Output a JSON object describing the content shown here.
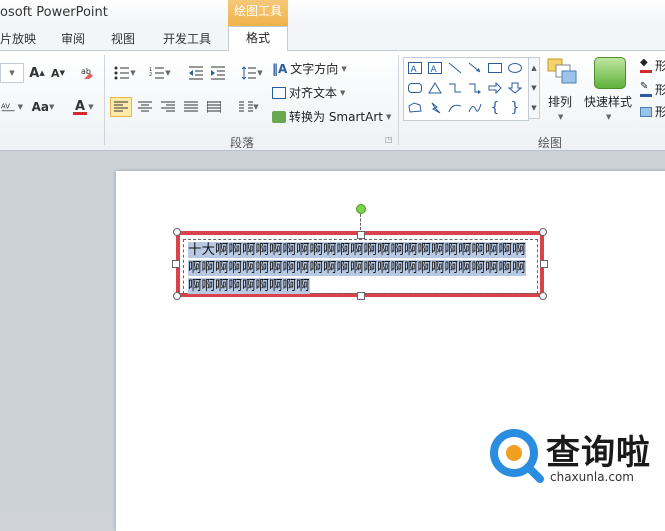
{
  "titlebar": {
    "app_title": "osoft PowerPoint",
    "context_group": "绘图工具"
  },
  "tabs": [
    {
      "label": "片放映"
    },
    {
      "label": "审阅"
    },
    {
      "label": "视图"
    },
    {
      "label": "开发工具"
    },
    {
      "label": "格式"
    }
  ],
  "ribbon": {
    "paragraph": {
      "label": "段落",
      "text_direction": "文字方向",
      "align_text": "对齐文本",
      "convert_smartart": "转换为 SmartArt"
    },
    "drawing": {
      "label": "绘图",
      "arrange": "排列",
      "quick_styles": "快速样式",
      "shape_fill": "形",
      "shape_outline": "形",
      "shape_effects": "形"
    },
    "font": {
      "change_case": "Aa"
    }
  },
  "slide": {
    "textbox_text": "十大啊啊啊啊啊啊啊啊啊啊啊啊啊啊啊啊啊啊啊啊啊啊啊啊啊啊啊啊啊啊啊啊啊啊啊啊啊啊啊啊啊啊啊啊啊啊啊啊啊啊啊啊啊啊啊啊啊"
  },
  "watermark": {
    "title": "查询啦",
    "url": "chaxunla.com"
  },
  "colors": {
    "selection_frame": "#d9434a",
    "text_highlight": "#b8c9e4",
    "context_tab": "#f2b34a"
  }
}
